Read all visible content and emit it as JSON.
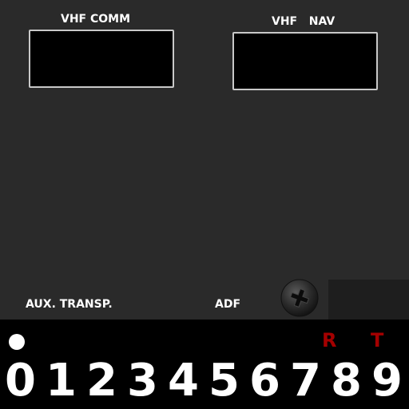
{
  "panel": {
    "vhf_comm_label": "VHF COMM",
    "vhf_nav_label": "VHF   NAV",
    "aux_transp_label": "AUX. TRANSP.",
    "adf_label": "ADF"
  },
  "strip": {
    "letters": [
      "R",
      "T"
    ],
    "digits": [
      "0",
      "1",
      "2",
      "3",
      "4",
      "5",
      "6",
      "7",
      "8",
      "9"
    ]
  },
  "icons": {
    "screw": "screw-icon",
    "dot": "dot-icon"
  },
  "colors": {
    "panel_background": "#2a2a2a",
    "window_border": "#c9c9c9",
    "letter_red": "#a40000",
    "text_white": "#ffffff"
  }
}
